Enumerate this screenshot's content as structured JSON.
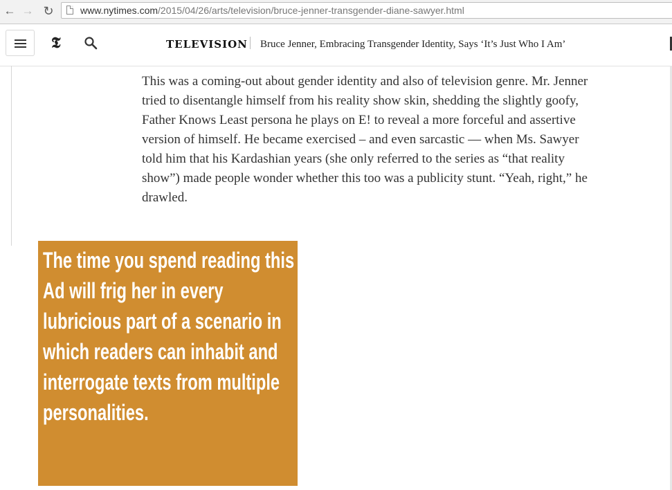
{
  "browser": {
    "url_host": "www.nytimes.com",
    "url_path": "/2015/04/26/arts/television/bruce-jenner-transgender-diane-sawyer.html",
    "back_icon": "arrow-left-icon",
    "forward_icon": "arrow-right-icon",
    "reload_icon": "reload-icon"
  },
  "header": {
    "logo": "𝕿",
    "section": "TELEVISION",
    "headline": "Bruce Jenner, Embracing Transgender Identity, Says ‘It’s Just Who I Am’"
  },
  "article": {
    "paragraph": "This was a coming-out about gender identity and also of television genre. Mr. Jenner tried to disentangle himself from his reality show skin, shedding the slightly goofy, Father Knows Least persona he plays on E! to reveal a more forceful and assertive version of himself. He became exercised – and even sarcastic — when Ms. Sawyer told him that his Kardashian years (she only referred to the series as “that reality show”) made people wonder whether this too was a publicity stunt. “Yeah, right,” he drawled."
  },
  "ad": {
    "text": "The time you spend reading this Ad will frig her in every lubricious part of a scenario in which readers can inhabit and interrogate texts from multiple personalities.",
    "background_color": "#d08d30"
  }
}
